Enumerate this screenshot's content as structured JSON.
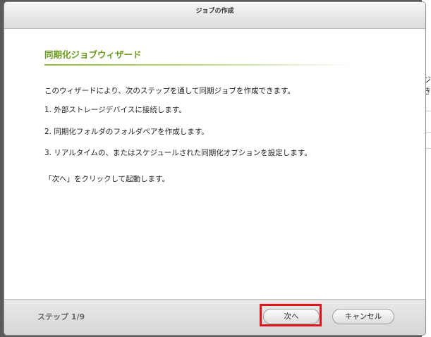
{
  "dialog": {
    "title": "ジョブの作成",
    "wizard_title": "同期化ジョブウィザード",
    "intro": "このウィザードにより、次のステップを通して同期ジョブを作成できます。",
    "steps": [
      "1. 外部ストレージデバイスに接続します。",
      "2. 同期化フォルダのフォルダペアを作成します。",
      "3. リアルタイムの、またはスケジュールされた同期化オプションを設定します。"
    ],
    "instruction": "「次へ」をクリックして起動します。"
  },
  "footer": {
    "step_label": "ステップ 1/9",
    "next_label": "次へ",
    "cancel_label": "キャンセル"
  },
  "background": {
    "glyphs": [
      "ジ",
      "き"
    ]
  },
  "colors": {
    "accent_green": "#6a9a1c",
    "highlight_red": "#e0141e"
  }
}
